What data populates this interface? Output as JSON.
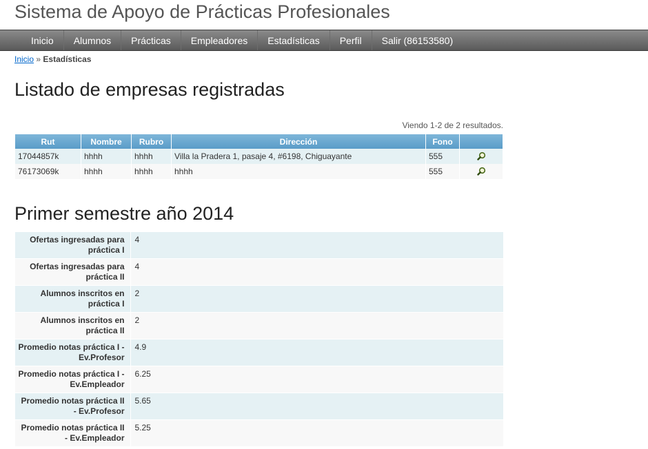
{
  "site": {
    "title": "Sistema de Apoyo de Prácticas Profesionales"
  },
  "nav": {
    "items": [
      {
        "label": "Inicio"
      },
      {
        "label": "Alumnos"
      },
      {
        "label": "Prácticas"
      },
      {
        "label": "Empleadores"
      },
      {
        "label": "Estadísticas"
      },
      {
        "label": "Perfil"
      },
      {
        "label": "Salir (86153580)"
      }
    ]
  },
  "breadcrumb": {
    "home": "Inicio",
    "separator": "»",
    "current": "Estadísticas"
  },
  "companies": {
    "heading": "Listado de empresas registradas",
    "summary": "Viendo 1-2 de 2 resultados.",
    "columns": [
      "Rut",
      "Nombre",
      "Rubro",
      "Dirección",
      "Fono",
      ""
    ],
    "rows": [
      {
        "rut": "17044857k",
        "nombre": "hhhh",
        "rubro": "hhhh",
        "direccion": "Villa la Pradera 1, pasaje 4, #6198, Chiguayante",
        "fono": "555",
        "icon": "magnifier-icon"
      },
      {
        "rut": "76173069k",
        "nombre": "hhhh",
        "rubro": "hhhh",
        "direccion": "hhhh",
        "fono": "555",
        "icon": "magnifier-icon"
      }
    ]
  },
  "semester": {
    "heading": "Primer semestre año 2014",
    "rows": [
      {
        "label": "Ofertas ingresadas para práctica I",
        "value": "4"
      },
      {
        "label": "Ofertas ingresadas para práctica II",
        "value": "4"
      },
      {
        "label": "Alumnos inscritos en práctica I",
        "value": "2"
      },
      {
        "label": "Alumnos inscritos en práctica II",
        "value": "2"
      },
      {
        "label": "Promedio notas práctica I - Ev.Profesor",
        "value": "4.9"
      },
      {
        "label": "Promedio notas práctica I - Ev.Empleador",
        "value": "6.25"
      },
      {
        "label": "Promedio notas práctica II - Ev.Profesor",
        "value": "5.65"
      },
      {
        "label": "Promedio notas práctica II - Ev.Empleador",
        "value": "5.25"
      }
    ]
  },
  "colors": {
    "header_blue": "#5a9cc8",
    "row_odd": "#e5f1f4",
    "row_even": "#f8f8f8",
    "nav_gray": "#6a6a6a",
    "link": "#0066cc"
  }
}
